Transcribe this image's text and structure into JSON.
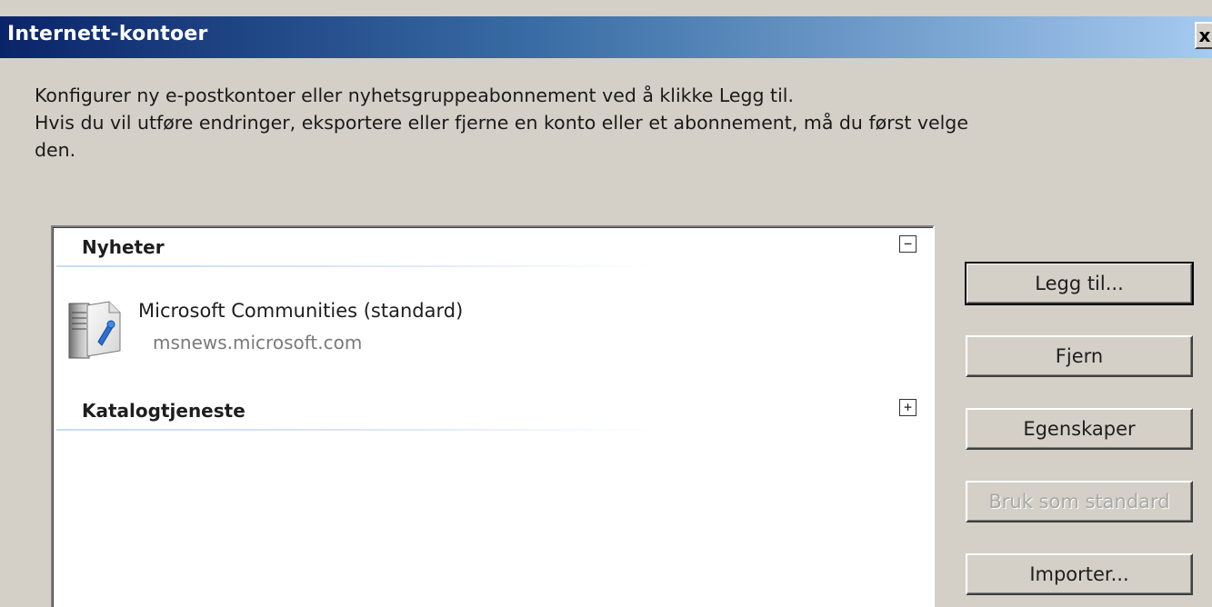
{
  "window": {
    "title": "Internett-kontoer",
    "close_label": "x"
  },
  "intro": {
    "line1": "Konfigurer ny e-postkontoer eller nyhetsgruppeabonnement ved å klikke Legg til.",
    "line2": "Hvis du vil utføre endringer, eksportere eller fjerne en konto eller et abonnement, må du først velge",
    "line3": "den."
  },
  "accounts_list": {
    "groups": [
      {
        "label": "Nyheter",
        "toggle": "−",
        "items": [
          {
            "name": "Microsoft Communities (standard)",
            "server": "msnews.microsoft.com",
            "icon": "news-server-icon"
          }
        ]
      },
      {
        "label": "Katalogtjeneste",
        "toggle": "+",
        "items": []
      }
    ]
  },
  "buttons": {
    "add": "Legg til...",
    "remove": "Fjern",
    "properties": "Egenskaper",
    "set_default": "Bruk som standard",
    "import": "Importer..."
  },
  "colors": {
    "titlebar_start": "#0a246a",
    "titlebar_end": "#a6caf0",
    "dialog_bg": "#d4d0c8",
    "disabled_text": "#a8a8a8"
  }
}
